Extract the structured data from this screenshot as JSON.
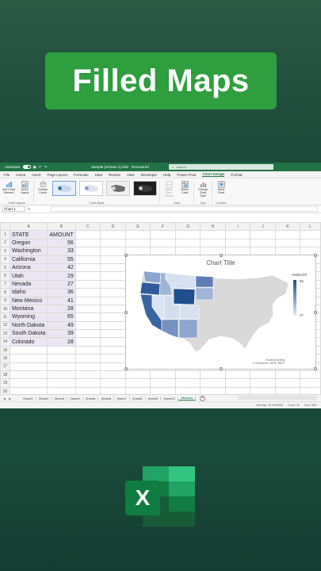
{
  "banner": {
    "title": "Filled Maps"
  },
  "titlebar": {
    "autosave": "AutoSave",
    "toggle_state": "On",
    "filename": "Sample (version 1).xlsb",
    "saved_status": "Recovered",
    "search_placeholder": "Search"
  },
  "menu": [
    "File",
    "Home",
    "Insert",
    "Page Layout",
    "Formulas",
    "Data",
    "Review",
    "View",
    "Developer",
    "Help",
    "Power Pivot",
    "Chart Design",
    "Format"
  ],
  "menu_active": "Chart Design",
  "ribbon": {
    "add_chart_element": "Add Chart Element",
    "quick_layout": "Quick Layout",
    "group_chart_layouts": "Chart Layouts",
    "change_colors": "Change Colors",
    "group_chart_styles": "Chart Styles",
    "switch_row_column": "Switch Row/ Column",
    "select_data": "Select Data",
    "group_data": "Data",
    "change_chart_type": "Change Chart Type",
    "group_type": "Type",
    "move_chart": "Move Chart",
    "group_location": "Location"
  },
  "formula_bar": {
    "name_box": "Chart 1",
    "fx": "fx"
  },
  "columns": [
    "A",
    "B",
    "C",
    "D",
    "E",
    "F",
    "G",
    "H",
    "I",
    "J",
    "K",
    "L"
  ],
  "rows": [
    "1",
    "2",
    "3",
    "4",
    "5",
    "6",
    "7",
    "8",
    "9",
    "10",
    "11",
    "12",
    "13",
    "14",
    "15",
    "16",
    "17",
    "18",
    "19",
    "20",
    "21"
  ],
  "table": {
    "header_state": "STATE",
    "header_amount": "AMOUNT",
    "rows": [
      {
        "state": "Oregon",
        "amount": "56"
      },
      {
        "state": "Washington",
        "amount": "33"
      },
      {
        "state": "California",
        "amount": "55"
      },
      {
        "state": "Arizona",
        "amount": "42"
      },
      {
        "state": "Utah",
        "amount": "29"
      },
      {
        "state": "Nevada",
        "amount": "27"
      },
      {
        "state": "Idaho",
        "amount": "36"
      },
      {
        "state": "New Mexico",
        "amount": "41"
      },
      {
        "state": "Montana",
        "amount": "28"
      },
      {
        "state": "Wyoming",
        "amount": "65"
      },
      {
        "state": "North Dakota",
        "amount": "49"
      },
      {
        "state": "South Dakota",
        "amount": "39"
      },
      {
        "state": "Colorado",
        "amount": "28"
      }
    ]
  },
  "chart": {
    "title": "Chart Title",
    "legend_title": "AMOUNT",
    "legend_max": "65",
    "legend_min": "27",
    "credit_line1": "Powered by Bing",
    "credit_line2": "© GeoNames, HERE, MSFT",
    "low_color": "#dde6f3",
    "high_color": "#1f4e8c"
  },
  "sheets": [
    "Sheet1",
    "Sheet2",
    "Sheet3",
    "Sheet4",
    "Sheet5",
    "Sheet6",
    "Sheet7",
    "Sheet8",
    "Sheet9",
    "Sheet10",
    "Sheet11"
  ],
  "active_sheet": "Sheet11",
  "status": {
    "average": "Average: 40.6153846",
    "count": "Count: 26",
    "sum": "Sum: 528"
  },
  "logo": {
    "letter": "X",
    "name": "excel-logo"
  },
  "colors": {
    "excel_green": "#217346",
    "banner_green": "#2f9e3f"
  }
}
